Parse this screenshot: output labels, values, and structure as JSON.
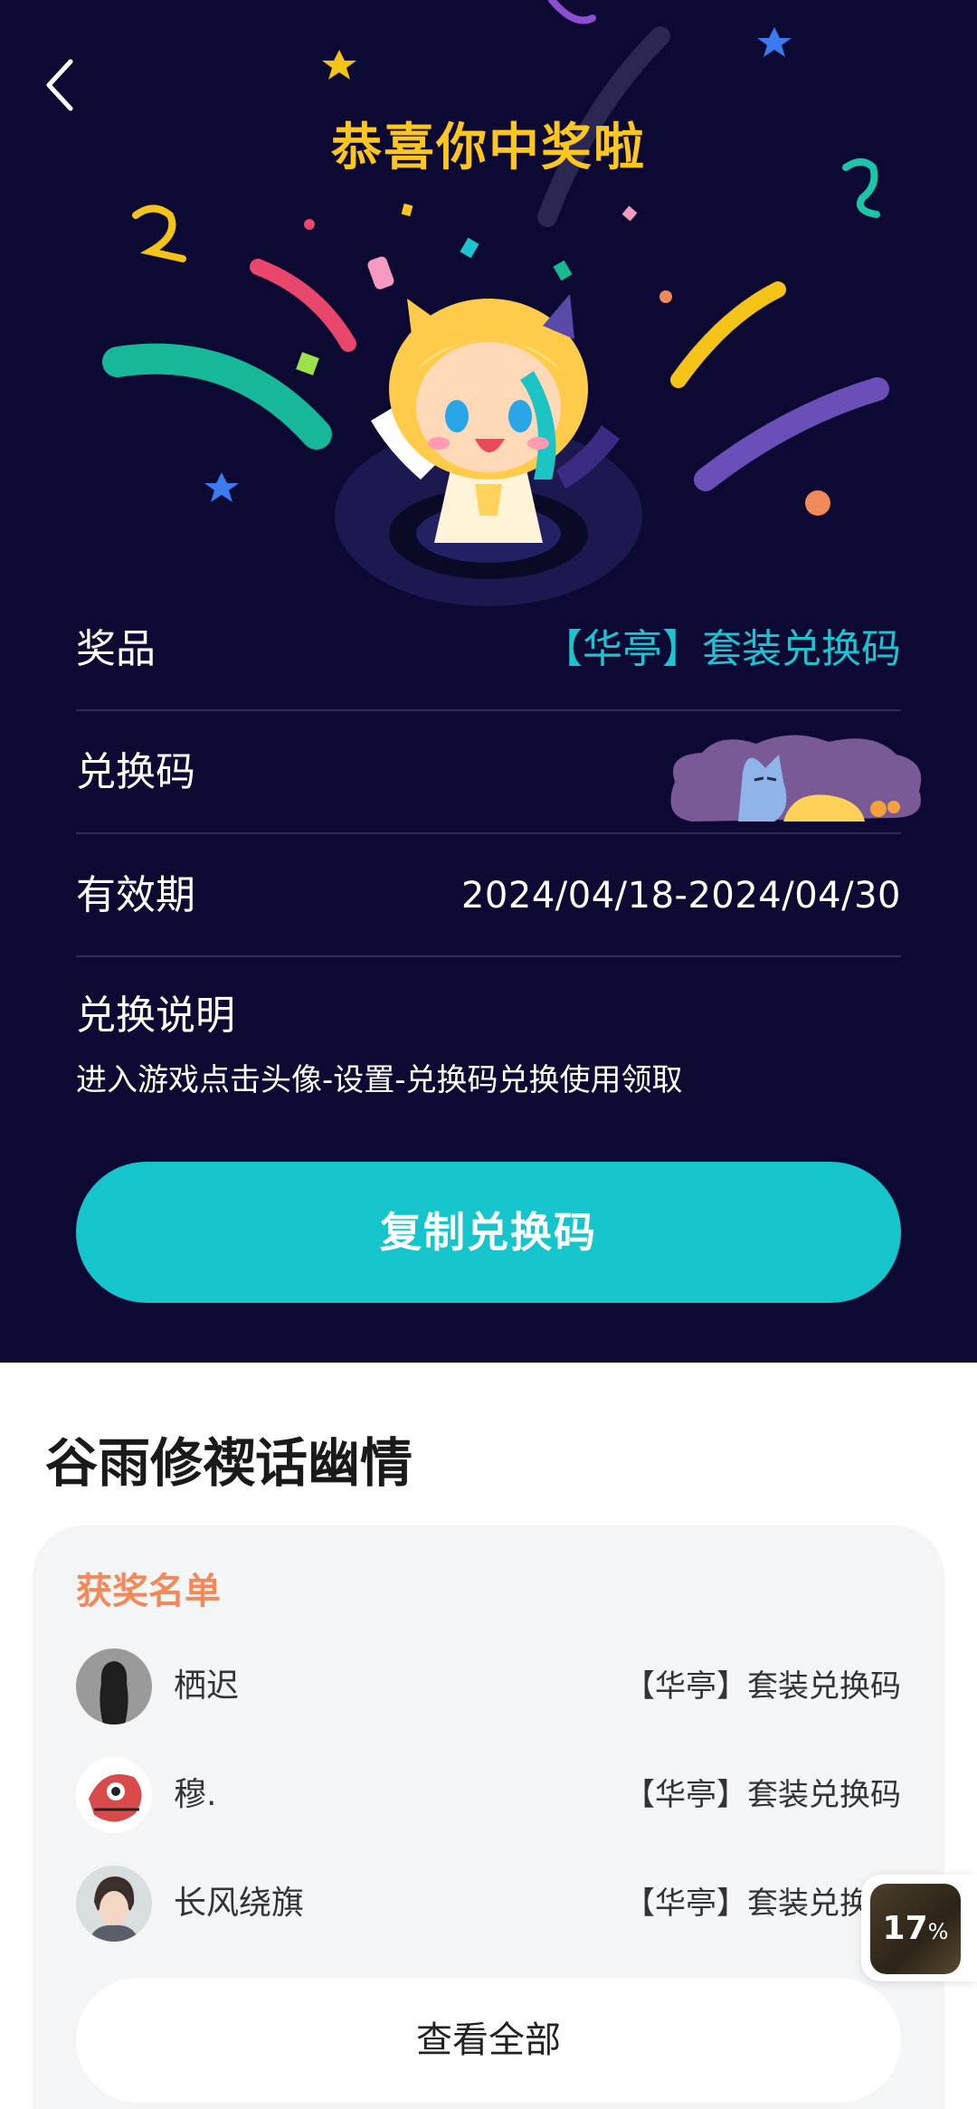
{
  "header": {
    "title": "恭喜你中奖啦",
    "back_icon": "chevron-left-icon"
  },
  "prize_info": {
    "prize_label": "奖品",
    "prize_value": "【华亭】套装兑换码",
    "code_label": "兑换码",
    "validity_label": "有效期",
    "validity_value": "2024/04/18-2024/04/30",
    "instructions_title": "兑换说明",
    "instructions_text": "进入游戏点击头像-设置-兑换码兑换使用领取"
  },
  "copy_button": {
    "label": "复制兑换码"
  },
  "activity": {
    "title": "谷雨修禊话幽情"
  },
  "winners": {
    "title": "获奖名单",
    "list": [
      {
        "name": "栖迟",
        "prize": "【华亭】套装兑换码"
      },
      {
        "name": "穆.",
        "prize": "【华亭】套装兑换码"
      },
      {
        "name": "长风绕旗",
        "prize": "【华亭】套装兑换码"
      }
    ],
    "view_all_label": "查看全部"
  },
  "float_widget": {
    "percent": "17",
    "unit": "%"
  },
  "colors": {
    "background_dark": "#0c0a33",
    "title_yellow": "#ffc61f",
    "accent_teal": "#16c4cc",
    "winners_title_orange": "#f2895a"
  }
}
